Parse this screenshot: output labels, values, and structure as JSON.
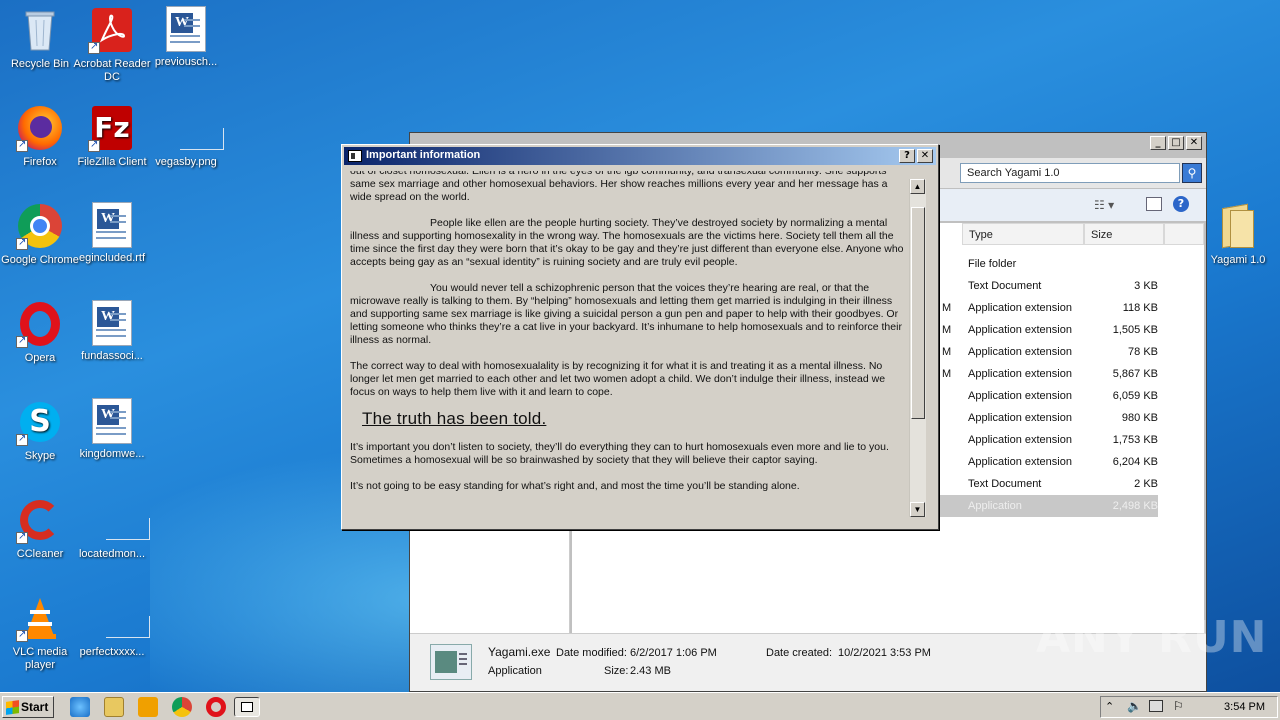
{
  "desktop": {
    "icons": [
      {
        "label": "Recycle Bin",
        "icon": "recycle-bin-icon"
      },
      {
        "label": "Acrobat Reader DC",
        "icon": "acrobat-icon"
      },
      {
        "label": "previousch...",
        "icon": "word-doc-icon"
      },
      {
        "label": "Firefox",
        "icon": "firefox-icon"
      },
      {
        "label": "FileZilla Client",
        "icon": "filezilla-icon"
      },
      {
        "label": "vegasby.png",
        "icon": "blank-file-icon"
      },
      {
        "label": "Google Chrome",
        "icon": "chrome-icon"
      },
      {
        "label": "egincluded.rtf",
        "icon": "word-doc-icon"
      },
      {
        "label": "Opera",
        "icon": "opera-icon"
      },
      {
        "label": "fundassoci...",
        "icon": "word-doc-icon"
      },
      {
        "label": "Skype",
        "icon": "skype-icon"
      },
      {
        "label": "kingdomwe...",
        "icon": "word-doc-icon"
      },
      {
        "label": "CCleaner",
        "icon": "ccleaner-icon"
      },
      {
        "label": "locatedmon...",
        "icon": "blank-file-icon"
      },
      {
        "label": "VLC media player",
        "icon": "vlc-icon"
      },
      {
        "label": "perfectxxxx...",
        "icon": "blank-file-icon"
      },
      {
        "label": "Yagami 1.0",
        "icon": "folder-icon"
      }
    ]
  },
  "explorer": {
    "search_placeholder": "Search Yagami 1.0",
    "columns": {
      "type": "Type",
      "size": "Size"
    },
    "rows": [
      {
        "frag": "",
        "type": "File folder",
        "size": ""
      },
      {
        "frag": "",
        "type": "Text Document",
        "size": "3 KB"
      },
      {
        "frag": "M",
        "type": "Application extension",
        "size": "118 KB"
      },
      {
        "frag": "M",
        "type": "Application extension",
        "size": "1,505 KB"
      },
      {
        "frag": "M",
        "type": "Application extension",
        "size": "78 KB"
      },
      {
        "frag": "M",
        "type": "Application extension",
        "size": "5,867 KB"
      },
      {
        "frag": "",
        "type": "Application extension",
        "size": "6,059 KB"
      },
      {
        "frag": "",
        "type": "Application extension",
        "size": "980 KB"
      },
      {
        "frag": "",
        "type": "Application extension",
        "size": "1,753 KB"
      },
      {
        "frag": "",
        "type": "Application extension",
        "size": "6,204 KB"
      },
      {
        "frag": "",
        "type": "Text Document",
        "size": "2 KB"
      },
      {
        "frag": "",
        "type": "Application",
        "size": "2,498 KB"
      }
    ],
    "details": {
      "name": "Yagami.exe",
      "kind": "Application",
      "modified_label": "Date modified:",
      "modified": "6/2/2017 1:06 PM",
      "size_label": "Size:",
      "size": "2.43 MB",
      "created_label": "Date created:",
      "created": "10/2/2021 3:53 PM"
    }
  },
  "dialog": {
    "title": "Important information",
    "help_glyph": "?",
    "close_glyph": "✕",
    "paragraphs": [
      "out of closet homosexual. Ellen is a hero in the eyes of the lgb community, and transexual community. She supports same sex marriage and other homosexual behaviors. Her show reaches millions every year and her message has a wide spread on the world.",
      "People like ellen are the people hurting society. They’ve destroyed society by normalizing a mental illness and supporting homosexality in the wrong way. The homosexuals are the victims here. Society tell them all the time since the first day they were born that it’s okay to be gay and they’re just different than everyone else. Anyone who accepts being gay as an “sexual identity” is ruining society and are truly evil people.",
      "You would never tell a schizophrenic person that the voices they’re hearing are real, or that the microwave really is talking to them. By “helping” homosexuals and letting them get married is indulging in their illness and supporting same sex marriage is like giving a suicidal person a gun pen and paper to help with their goodbyes. Or letting someone who thinks they’re a cat live in your backyard. It’s inhumane to help homosexuals and to reinforce their illness as normal.",
      "The correct way to deal with homosexualality is by recognizing it for what it is and treating it as a mental illness. No longer let men get married to each other and let two women adopt a child. We don’t indulge their illness, instead we focus on ways to help them live with it and learn to cope."
    ],
    "heading": "The truth has been told.",
    "paragraphs_after": [
      "It’s important you don’t listen to society, they’ll do everything they can to hurt homosexuals even more and lie to you. Sometimes a homosexual will be so brainwashed by society that they will believe their captor saying.",
      "It’s not going to be easy standing for what’s right and, and most the time you’ll be standing alone."
    ]
  },
  "taskbar": {
    "start_label": "Start",
    "clock": "3:54 PM"
  },
  "watermark": "ANY RUN"
}
